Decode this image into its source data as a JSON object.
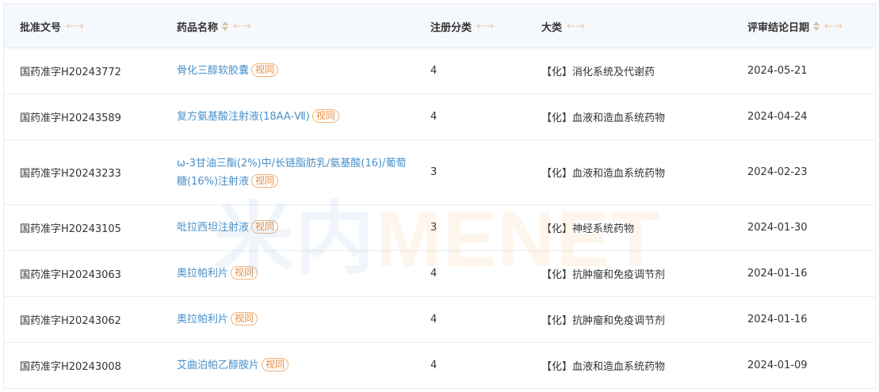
{
  "headers": {
    "approval_no": "批准文号",
    "drug_name": "药品名称",
    "reg_class": "注册分类",
    "category": "大类",
    "review_date": "评审结论日期",
    "arrows_glyph": "←→"
  },
  "badge_label": "视同",
  "watermark": {
    "part_a": "米内",
    "part_b": "MENET"
  },
  "rows": [
    {
      "approval_no": "国药准字H20243772",
      "drug_name": "骨化三醇软胶囊",
      "reg_class": "4",
      "category": "【化】消化系统及代谢药",
      "review_date": "2024-05-21"
    },
    {
      "approval_no": "国药准字H20243589",
      "drug_name": "复方氨基酸注射液(18AA-Ⅶ)",
      "reg_class": "4",
      "category": "【化】血液和造血系统药物",
      "review_date": "2024-04-24"
    },
    {
      "approval_no": "国药准字H20243233",
      "drug_name": "ω-3甘油三酯(2%)中/长链脂肪乳/氨基酸(16)/葡萄糖(16%)注射液",
      "reg_class": "3",
      "category": "【化】血液和造血系统药物",
      "review_date": "2024-02-23"
    },
    {
      "approval_no": "国药准字H20243105",
      "drug_name": "吡拉西坦注射液",
      "reg_class": "3",
      "category": "【化】神经系统药物",
      "review_date": "2024-01-30"
    },
    {
      "approval_no": "国药准字H20243063",
      "drug_name": "奥拉帕利片",
      "reg_class": "4",
      "category": "【化】抗肿瘤和免疫调节剂",
      "review_date": "2024-01-16"
    },
    {
      "approval_no": "国药准字H20243062",
      "drug_name": "奥拉帕利片",
      "reg_class": "4",
      "category": "【化】抗肿瘤和免疫调节剂",
      "review_date": "2024-01-16"
    },
    {
      "approval_no": "国药准字H20243008",
      "drug_name": "艾曲泊帕乙醇胺片",
      "reg_class": "4",
      "category": "【化】血液和造血系统药物",
      "review_date": "2024-01-09"
    }
  ]
}
